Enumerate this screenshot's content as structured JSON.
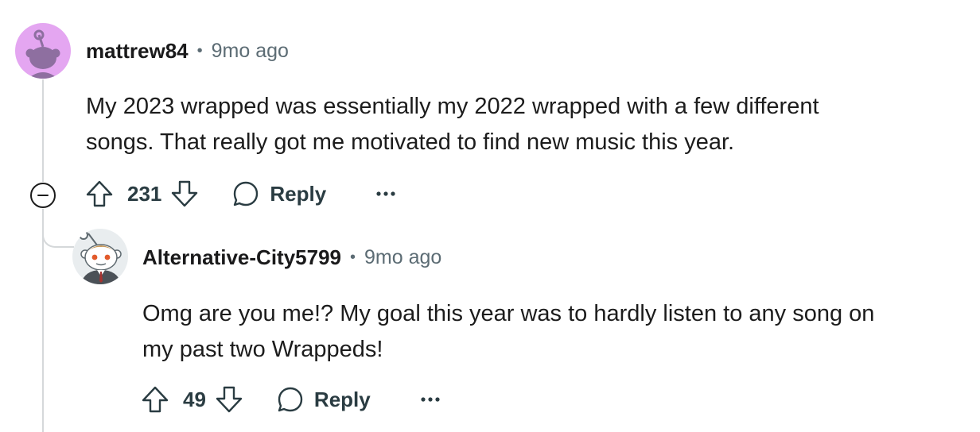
{
  "comment": {
    "username": "mattrew84",
    "separator": "•",
    "time": "9mo ago",
    "body_lines": [
      "My 2023 wrapped was essentially my 2022 wrapped with a few different",
      "songs. That really got me motivated to find new music this year."
    ],
    "score": "231",
    "reply_label": "Reply",
    "avatar_icon": "snoo-avatar-icon",
    "colors": {
      "avatar_bg": "#e4a6f1",
      "avatar_snoo": "#8e6fa0"
    }
  },
  "reply": {
    "username": "Alternative-City5799",
    "separator": "•",
    "time": "9mo ago",
    "body_lines": [
      "Omg are you me!? My goal this year was to hardly listen to any song on",
      "my past two Wrappeds!"
    ],
    "score": "49",
    "reply_label": "Reply",
    "avatar_icon": "snoo-suit-avatar-icon"
  },
  "icons": [
    "collapse-icon",
    "upvote-icon",
    "downvote-icon",
    "comment-bubble-icon",
    "more-options-icon"
  ],
  "colors": {
    "thread_line": "#d5d8da",
    "meta_text": "#5c6c74",
    "action_text": "#2a3c42"
  }
}
